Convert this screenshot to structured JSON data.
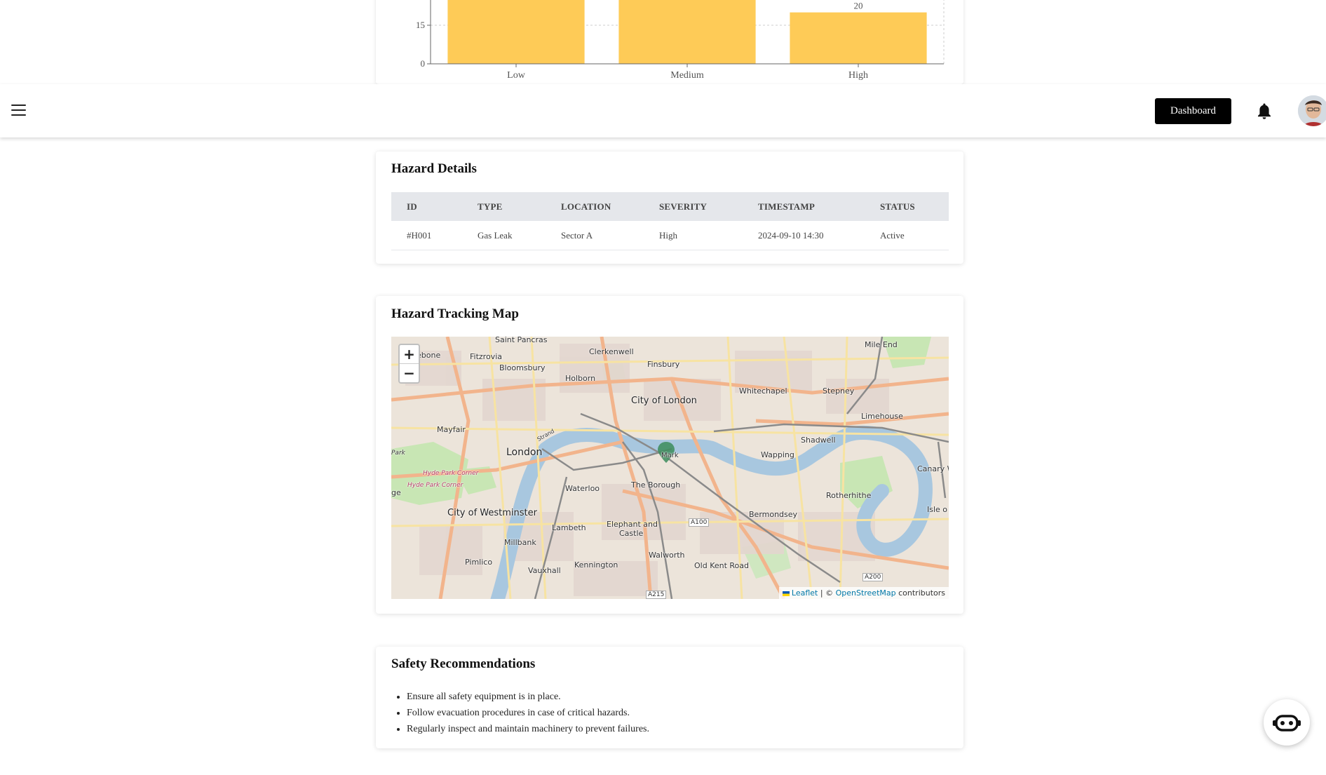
{
  "chart_data": {
    "type": "bar",
    "categories": [
      "Low",
      "Medium",
      "High"
    ],
    "values": [
      30,
      30,
      20
    ],
    "data_labels": [
      "",
      "",
      "20"
    ],
    "y_ticks": [
      0,
      15
    ],
    "color": "#fecb57",
    "grid": true
  },
  "topbar": {
    "dashboard_label": "Dashboard"
  },
  "hazard_details": {
    "title": "Hazard Details",
    "columns": [
      "ID",
      "TYPE",
      "LOCATION",
      "SEVERITY",
      "TIMESTAMP",
      "STATUS"
    ],
    "rows": [
      [
        "#H001",
        "Gas Leak",
        "Sector A",
        "High",
        "2024-09-10 14:30",
        "Active"
      ]
    ]
  },
  "hazard_map": {
    "title": "Hazard Tracking Map",
    "zoom_in": "+",
    "zoom_out": "−",
    "attribution": {
      "leaflet": "Leaflet",
      "sep": " | © ",
      "osm": "OpenStreetMap",
      "suffix": " contributors"
    },
    "marker_label": "Mark",
    "labels": {
      "saint_pancras": "Saint Pancras",
      "clerkenwell": "Clerkenwell",
      "ebone": "ebone",
      "fitzrovia": "Fitzrovia",
      "bloomsbury": "Bloomsbury",
      "finsbury": "Finsbury",
      "holborn": "Holborn",
      "mile_end": "Mile End",
      "whitechapel": "Whitechapel",
      "stepney": "Stepney",
      "city_of_london": "City of London",
      "limehouse": "Limehouse",
      "mayfair": "Mayfair",
      "strand": "Strand",
      "shadwell": "Shadwell",
      "park": "Park",
      "london": "London",
      "wapping": "Wapping",
      "hyde_park_corner_1": "Hyde Park Corner",
      "hyde_park_corner_2": "Hyde Park Corner",
      "canary": "Canary W",
      "waterloo": "Waterloo",
      "the_borough": "The Borough",
      "ge": "ge",
      "rotherhithe": "Rotherhithe",
      "city_of_westminster": "City of Westminster",
      "bermondsey": "Bermondsey",
      "isle_of": "Isle o",
      "lambeth": "Lambeth",
      "elephant": "Elephant and",
      "castle": "Castle",
      "a100": "A100",
      "millbank": "Millbank",
      "walworth": "Walworth",
      "pimlico": "Pimlico",
      "kennington": "Kennington",
      "old_kent_road": "Old Kent Road",
      "vauxhall": "Vauxhall",
      "a200": "A200",
      "a215": "A215"
    }
  },
  "safety": {
    "title": "Safety Recommendations",
    "items": [
      "Ensure all safety equipment is in place.",
      "Follow evacuation procedures in case of critical hazards.",
      "Regularly inspect and maintain machinery to prevent failures."
    ]
  }
}
